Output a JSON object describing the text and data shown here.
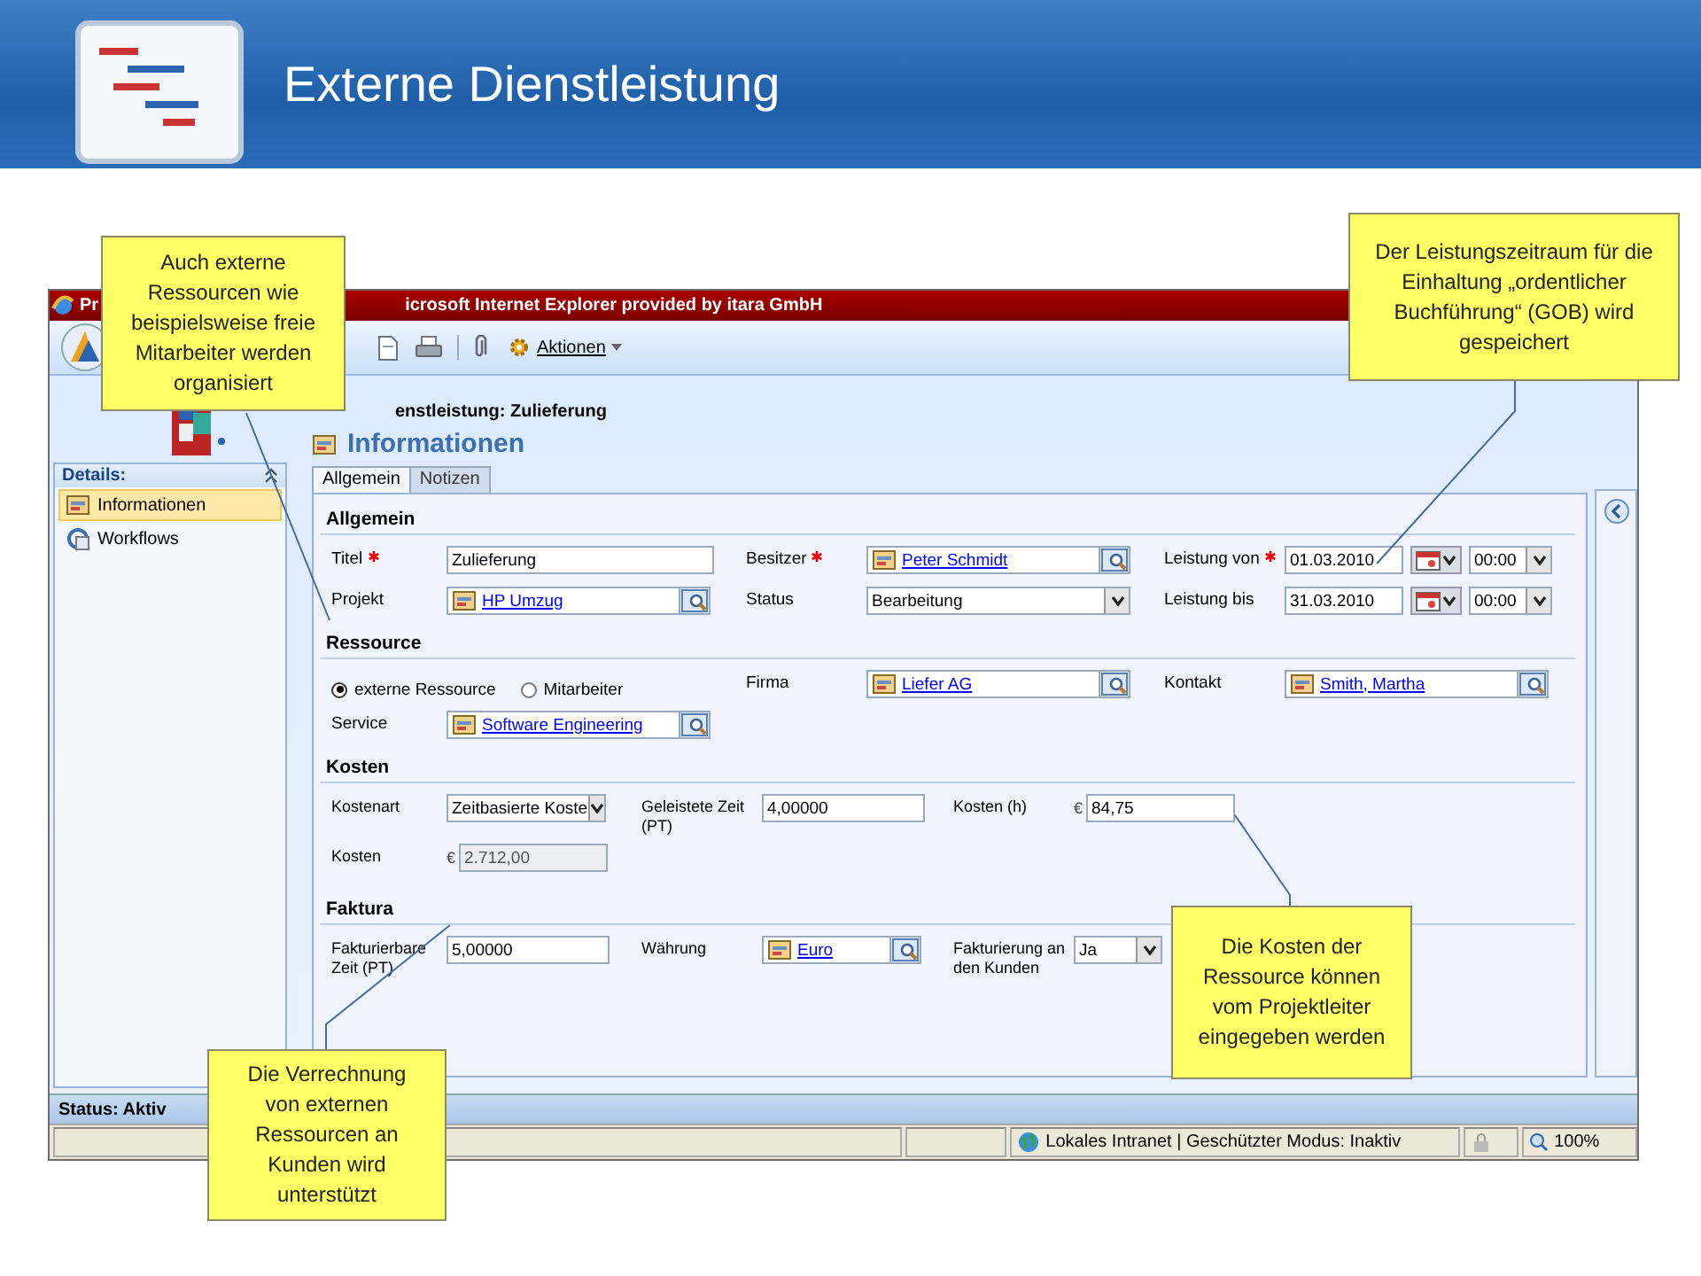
{
  "slide": {
    "title": "Externe Dienstleistung"
  },
  "window": {
    "title_start": "Pr",
    "title_end": "icrosoft Internet Explorer provided by itara GmbH"
  },
  "toolbar": {
    "actions_label": "Aktionen"
  },
  "record": {
    "subtitle": "enstleistung: Zulieferung",
    "heading": "Informationen"
  },
  "sidebar": {
    "title": "Details:",
    "items": [
      {
        "label": "Informationen",
        "selected": true
      },
      {
        "label": "Workflows",
        "selected": false
      }
    ]
  },
  "tabs": [
    {
      "label": "Allgemein",
      "selected": true
    },
    {
      "label": "Notizen",
      "selected": false
    }
  ],
  "sections": [
    {
      "title": "Allgemein",
      "rows": [
        [
          {
            "label": "Titel",
            "required": true,
            "kind": "text",
            "value": "Zulieferung"
          },
          {
            "label": "Besitzer",
            "required": true,
            "kind": "lookup",
            "value": "Peter Schmidt"
          },
          {
            "label": "Leistung von",
            "required": true,
            "kind": "date",
            "value": "01.03.2010",
            "time": "00:00"
          }
        ],
        [
          {
            "label": "Projekt",
            "required": false,
            "kind": "lookup",
            "value": "HP Umzug"
          },
          {
            "label": "Status",
            "required": false,
            "kind": "select",
            "value": "Bearbeitung"
          },
          {
            "label": "Leistung bis",
            "required": false,
            "kind": "date",
            "value": "31.03.2010",
            "time": "00:00"
          }
        ]
      ]
    },
    {
      "title": "Ressource",
      "rows": [
        [
          {
            "kind": "radio",
            "options": [
              {
                "label": "externe Ressource",
                "selected": true
              },
              {
                "label": "Mitarbeiter",
                "selected": false
              }
            ]
          },
          {
            "label": "Firma",
            "required": false,
            "kind": "lookup",
            "value": "Liefer AG"
          },
          {
            "label": "Kontakt",
            "required": false,
            "kind": "lookup",
            "value": "Smith, Martha"
          }
        ],
        [
          {
            "label": "Service",
            "required": false,
            "kind": "lookup",
            "value": "Software Engineering"
          }
        ]
      ]
    },
    {
      "title": "Kosten",
      "rows": [
        [
          {
            "label": "Kostenart",
            "required": false,
            "kind": "select",
            "value": "Zeitbasierte Koste"
          },
          {
            "label": "Geleistete Zeit (PT)",
            "required": false,
            "kind": "text",
            "value": "4,00000"
          },
          {
            "label": "Kosten (h)",
            "required": false,
            "kind": "currency",
            "symbol": "€",
            "value": "84,75",
            "disabled": false
          }
        ],
        [
          {
            "label": "Kosten",
            "required": false,
            "kind": "currency",
            "symbol": "€",
            "value": "2.712,00",
            "disabled": true
          }
        ]
      ]
    },
    {
      "title": "Faktura",
      "rows": [
        [
          {
            "label": "Fakturierbare Zeit (PT)",
            "required": false,
            "kind": "text",
            "value": "5,00000"
          },
          {
            "label": "Währung",
            "required": false,
            "kind": "lookup",
            "value": "Euro"
          },
          {
            "label": "Fakturierung an den Kunden",
            "required": false,
            "kind": "select",
            "value": "Ja"
          }
        ]
      ]
    }
  ],
  "status": "Status: Aktiv",
  "ie_status": {
    "zone": "Lokales Intranet | Geschützter Modus: Inaktiv",
    "zoom": "100%"
  },
  "callouts": [
    {
      "text": "Auch externe Ressourcen wie beispielsweise freie Mitarbeiter werden organisiert"
    },
    {
      "text": "Der Leistungszeitraum für die Einhaltung „ordentlicher Buchführung“ (GOB) wird gespeichert"
    },
    {
      "text": "Die Kosten der Ressource können vom Projektleiter eingegeben werden"
    },
    {
      "text": "Die Verrechnung von externen Ressourcen an Kunden wird unterstützt"
    }
  ]
}
